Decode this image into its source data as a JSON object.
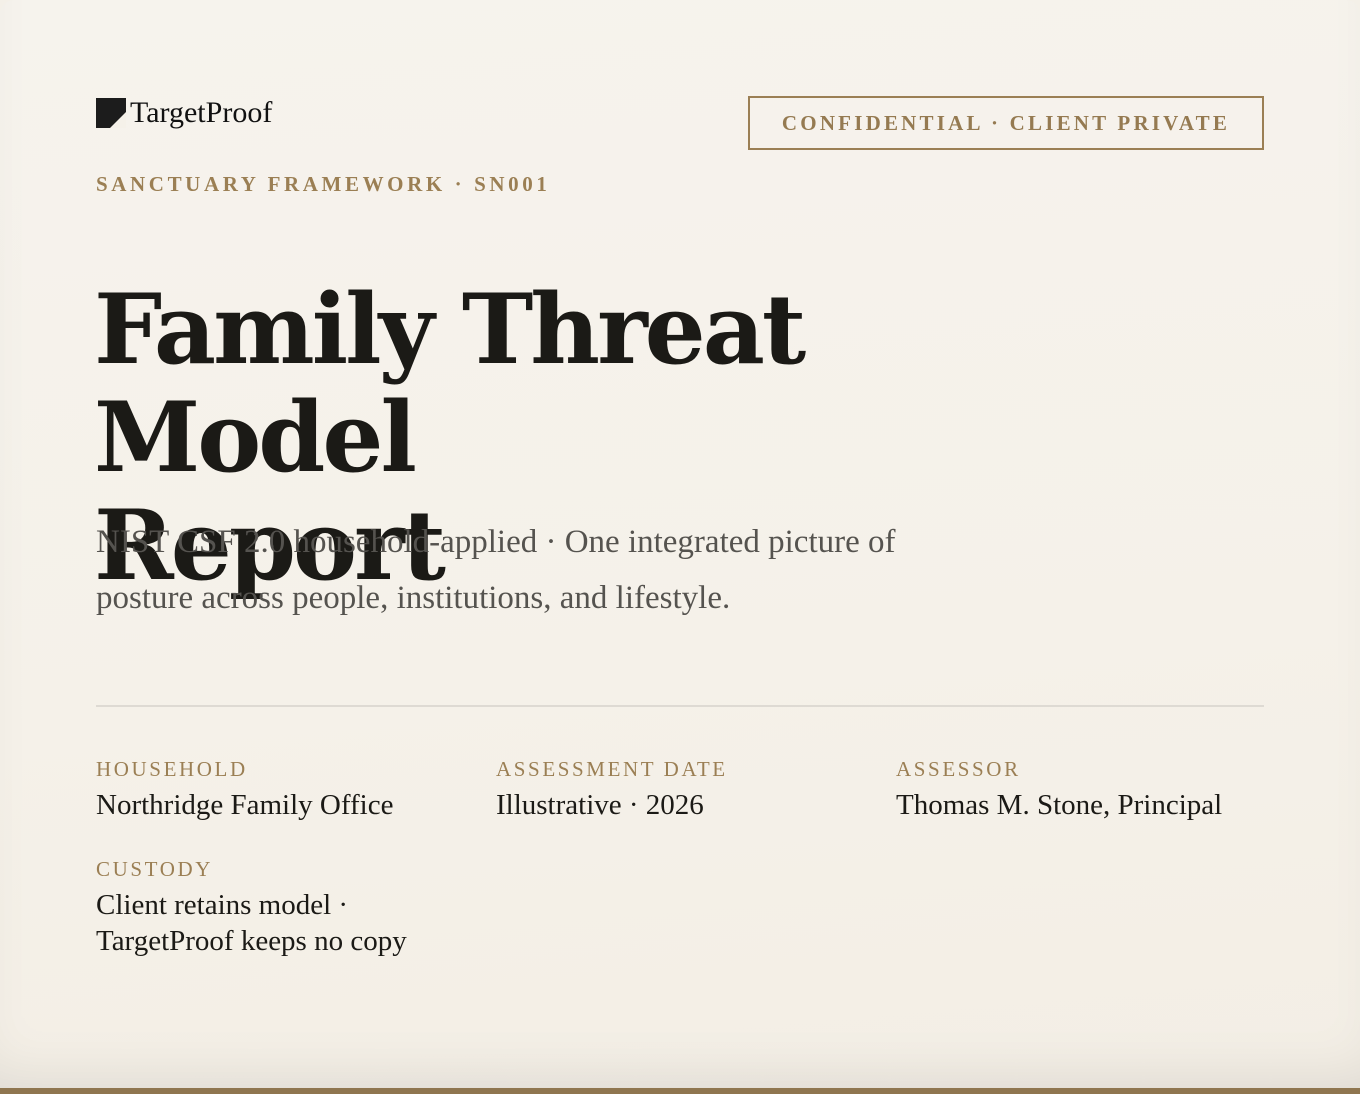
{
  "brand": {
    "logo_text": "TargetProof"
  },
  "badge": {
    "text": "CONFIDENTIAL · CLIENT PRIVATE"
  },
  "eyebrow": "SANCTUARY FRAMEWORK · SN001",
  "title": {
    "line1": "Family Threat Model",
    "line2": "Report"
  },
  "subtitle": "NIST CSF 2.0 household-applied · One integrated picture of posture across people, institutions, and lifestyle.",
  "meta": {
    "household": {
      "label": "HOUSEHOLD",
      "value": "Northridge Family Office"
    },
    "assessment_date": {
      "label": "ASSESSMENT DATE",
      "value": "Illustrative · 2026"
    },
    "assessor": {
      "label": "ASSESSOR",
      "value": "Thomas M. Stone, Principal"
    },
    "custody": {
      "label": "CUSTODY",
      "value": "Client retains model · TargetProof keeps no copy"
    }
  },
  "colors": {
    "accent": "#9b7f54",
    "background": "#f5f1e9",
    "text": "#1b1a16",
    "muted": "#55534f"
  }
}
